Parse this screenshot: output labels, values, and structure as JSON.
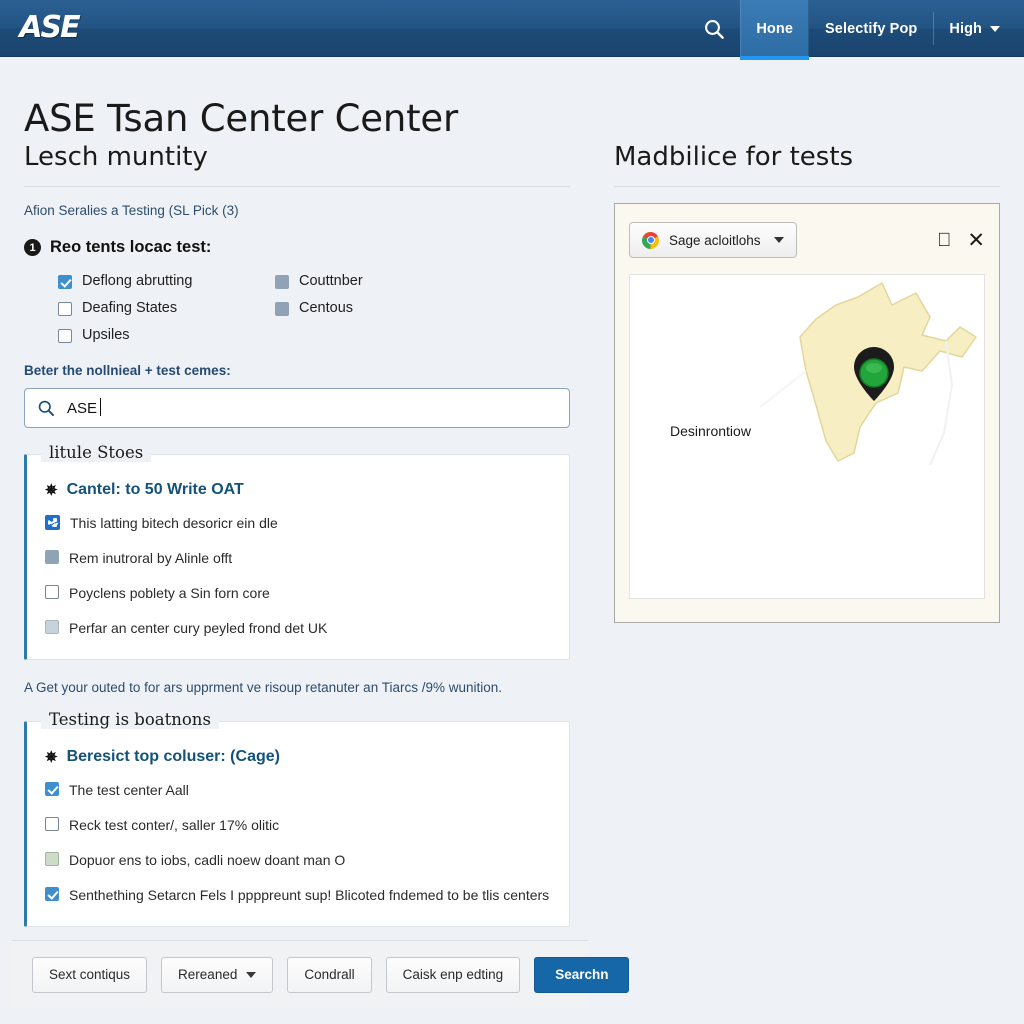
{
  "topbar": {
    "logo_text": "ASE",
    "search_icon": "search-icon",
    "items": [
      {
        "label": "Hone",
        "active": true
      },
      {
        "label": "Selectify Pop",
        "active": false
      },
      {
        "label": "High",
        "active": false,
        "caret": true
      }
    ]
  },
  "page": {
    "title": "ASE Tsan Center Center"
  },
  "left": {
    "section_title": "Lesch muntity",
    "subnote": "Afion Seralies a Testing (SL Pick (3)",
    "step": {
      "number": "1",
      "label": "Reo tents locac test:"
    },
    "checkboxes": [
      {
        "label": "Deflong abrutting",
        "state": "on"
      },
      {
        "label": "Couttnber",
        "state": "dim"
      },
      {
        "label": "Deafing States",
        "state": "off"
      },
      {
        "label": "Centous",
        "state": "dim"
      },
      {
        "label": "Upsiles",
        "state": "off"
      },
      {
        "label": "",
        "state": "none"
      }
    ],
    "field_label": "Beter the nollnieal + test cemes:",
    "search": {
      "value": "ASE",
      "icon": "search-icon"
    },
    "panel1": {
      "legend": "litule Stoes",
      "title": "Cantel: to 50 Write OAT",
      "title_icon": "star-icon",
      "rows": [
        {
          "label": "This latting bitech desoricr ein dle",
          "icon": "share-icon"
        },
        {
          "label": "Rem inutroral by Alinle offt",
          "icon": "checkbox",
          "state": "dim"
        },
        {
          "label": "Poyclens poblety a Sin forn core",
          "icon": "checkbox",
          "state": "off"
        },
        {
          "label": "Perfar an center cury peyled frond det UK",
          "icon": "checkbox",
          "state": "gray"
        }
      ]
    },
    "hint": "A Get your outed to for ars upprment ve risoup retanuter an Tiarcs /9% wunition.",
    "panel2": {
      "legend": "Testing is boatnons",
      "title": "Beresict top coluser: (Cage)",
      "title_icon": "star-icon",
      "rows": [
        {
          "label": "The test center Aall",
          "icon": "checkbox",
          "state": "on"
        },
        {
          "label": "Reck test conter/, saller 17% olitic",
          "icon": "checkbox",
          "state": "off"
        },
        {
          "label": "Dopuor ens to iobs, cadli noew doant man O",
          "icon": "checkbox",
          "state": "green"
        },
        {
          "label": "Senthething Setarcn Fels I ppppreunt sup! Blicoted fndemed to be tlis centers",
          "icon": "checkbox",
          "state": "on"
        }
      ]
    }
  },
  "actionbar": {
    "buttons": [
      {
        "label": "Sext contiqus",
        "kind": "default"
      },
      {
        "label": "Rereaned",
        "kind": "dropdown"
      },
      {
        "label": "Condrall",
        "kind": "default"
      },
      {
        "label": "Caisk enp edting",
        "kind": "default"
      },
      {
        "label": "Searchn",
        "kind": "primary"
      }
    ]
  },
  "right": {
    "section_title": "Madbilice for tests",
    "map": {
      "select_label": "Sage acloitlohs",
      "select_icon": "chrome-icon",
      "apple_icon": "apple-icon",
      "close_icon": "close-icon",
      "marker_label": "Desinrontiow",
      "marker_color": "#22a63b",
      "region_fill": "#f7eec4"
    }
  },
  "colors": {
    "brand_blue": "#225483",
    "accent_blue": "#1667a8",
    "page_bg": "#eef2f6",
    "panel_border_left": "#2e7aa8"
  }
}
